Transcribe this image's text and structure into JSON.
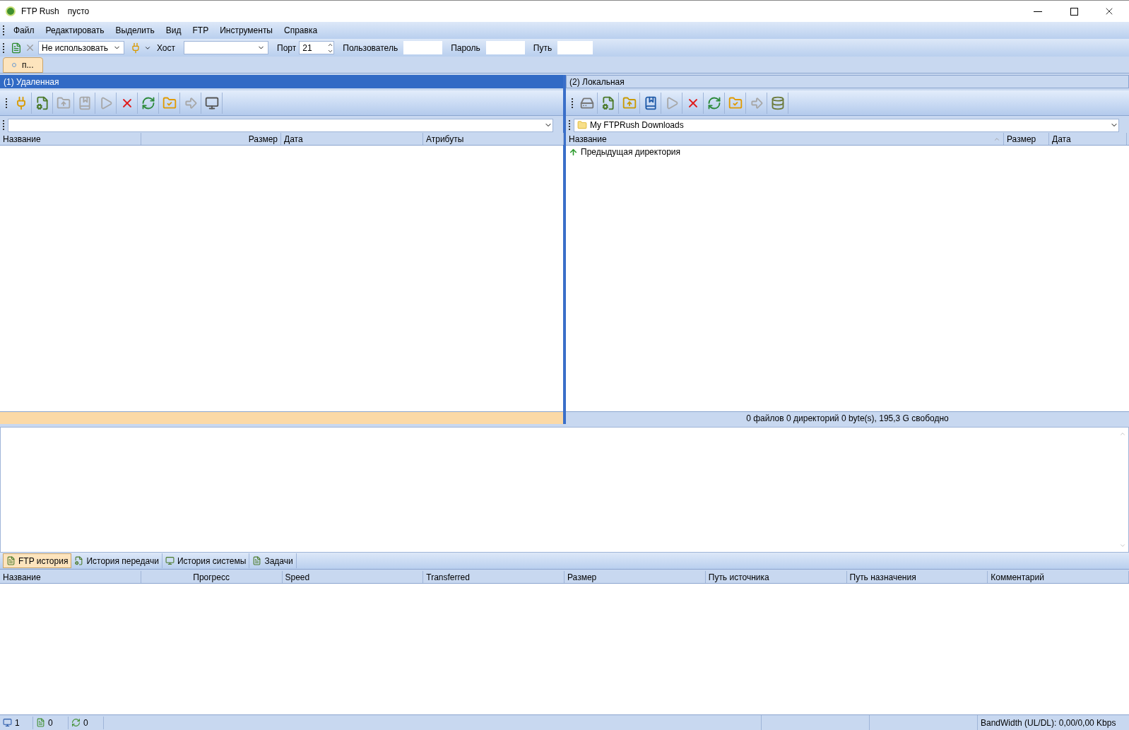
{
  "window": {
    "title": "FTP Rush",
    "subtitle": "пусто"
  },
  "menu": [
    "Файл",
    "Редактировать",
    "Выделить",
    "Вид",
    "FTP",
    "Инструменты",
    "Справка"
  ],
  "connect_bar": {
    "proxy": "Не использовать",
    "host_label": "Хост",
    "port_label": "Порт",
    "port": "21",
    "user_label": "Пользователь",
    "password_label": "Пароль",
    "path_label": "Путь"
  },
  "session_tabs": [
    {
      "label": "п...",
      "selected": true
    }
  ],
  "panels": [
    {
      "title": "(1) Удаленная",
      "selected": true,
      "tools": [
        {
          "kind": "connect",
          "disabled": false
        },
        {
          "kind": "sync",
          "disabled": false
        },
        {
          "kind": "up",
          "disabled": true
        },
        {
          "kind": "bookmark",
          "disabled": true
        },
        {
          "kind": "play",
          "disabled": true
        },
        {
          "kind": "stop",
          "disabled": false
        },
        {
          "kind": "refresh",
          "disabled": false
        },
        {
          "kind": "folder",
          "disabled": false
        },
        {
          "kind": "transfer",
          "disabled": true
        },
        {
          "kind": "terminal",
          "disabled": false
        }
      ],
      "columns": [
        {
          "label": "Название",
          "sorted": false
        },
        {
          "label": "Размер",
          "sorted": false
        },
        {
          "label": "Дата",
          "sorted": false
        },
        {
          "label": "Атрибуты",
          "sorted": false
        }
      ]
    },
    {
      "title": "(2) Локальная",
      "selected": false,
      "path": "My FTPRush Downloads",
      "tools": [
        {
          "kind": "drive",
          "disabled": false
        },
        {
          "kind": "sync",
          "disabled": false
        },
        {
          "kind": "up",
          "disabled": false
        },
        {
          "kind": "bookmark",
          "disabled": false
        },
        {
          "kind": "play",
          "disabled": true
        },
        {
          "kind": "stop",
          "disabled": false
        },
        {
          "kind": "refresh",
          "disabled": false
        },
        {
          "kind": "folder",
          "disabled": false
        },
        {
          "kind": "transfer",
          "disabled": true
        },
        {
          "kind": "list",
          "disabled": false
        }
      ],
      "columns": [
        {
          "label": "Название",
          "sorted": true
        },
        {
          "label": "Размер",
          "sorted": false
        },
        {
          "label": "Дата",
          "sorted": false
        }
      ],
      "rows": [
        {
          "name": "Предыдущая директория"
        }
      ],
      "status": "0 файлов 0 директорий 0 byte(s), 195,3 G свободно"
    }
  ],
  "log_tabs": [
    {
      "label": "FTP история",
      "selected": true
    },
    {
      "label": "История передачи",
      "selected": false
    },
    {
      "label": "История системы",
      "selected": false
    },
    {
      "label": "Задачи",
      "selected": false
    }
  ],
  "transfer_columns": [
    "Название",
    "Прогресс",
    "Speed",
    "Transferred",
    "Размер",
    "Путь источника",
    "Путь назначения",
    "Комментарий"
  ],
  "status_bar": {
    "windows": "1",
    "queue": "0",
    "transfers": "0",
    "bandwidth": "BandWidth (UL/DL): 0,00/0,00 Kbps"
  }
}
